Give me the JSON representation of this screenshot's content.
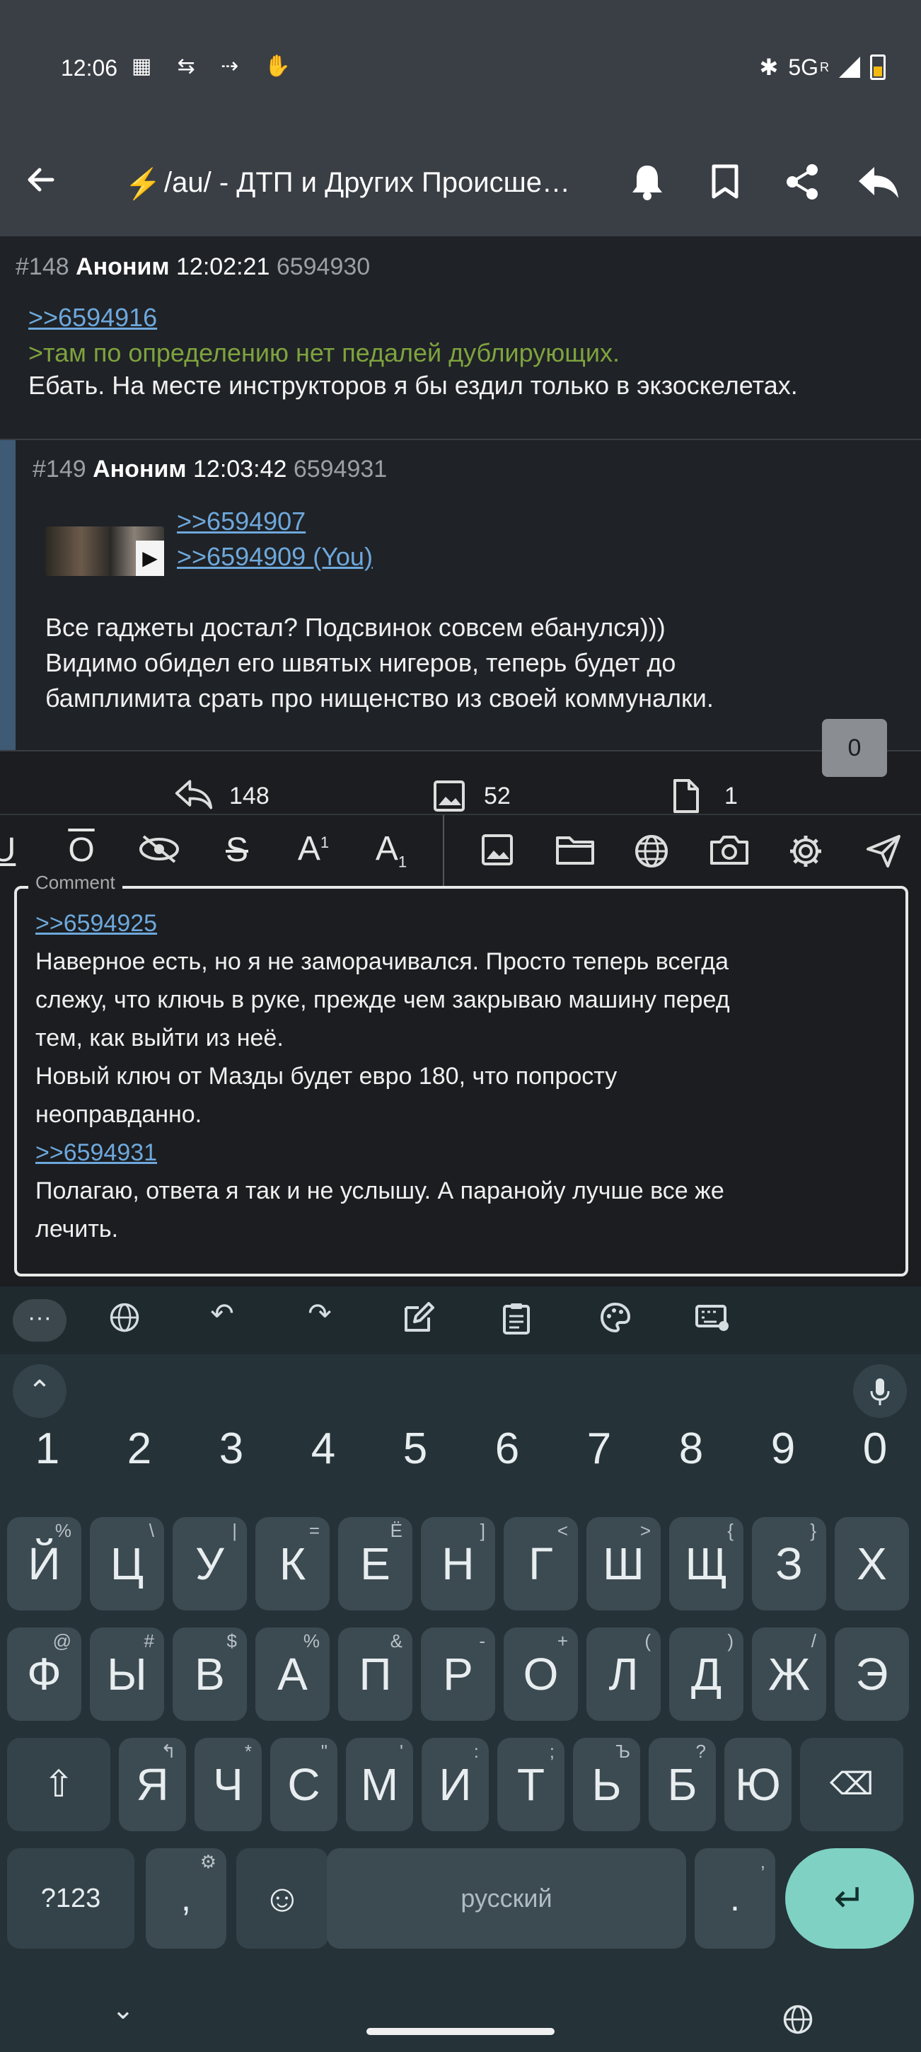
{
  "status_bar": {
    "time": "12:06",
    "left_icons": "▦ ⇆ ⇢ ✋",
    "network": "5G",
    "network_sup": "R"
  },
  "app_bar": {
    "title": "/au/ - ДТП и Других Происшест...",
    "back_icon": "arrow-left-icon",
    "icons": [
      "bell-icon",
      "bookmark-icon",
      "share-icon",
      "reply-icon"
    ]
  },
  "posts": [
    {
      "num": "#148",
      "author": "Аноним",
      "time": "12:02:21",
      "id": "6594930",
      "reply_link": ">>6594916",
      "quote": ">там по определению нет педалей дублирующих.",
      "text": "Ебать. На месте инструкторов я бы ездил только в экзоскелетах."
    },
    {
      "num": "#149",
      "author": "Аноним",
      "time": "12:03:42",
      "id": "6594931",
      "reply_links": [
        ">>6594907",
        ">>6594909 (You)"
      ],
      "text_lines": [
        "Все гаджеты достал? Подсвинок совсем ебанулся)))",
        "Видимо обидел его швятых нигеров, теперь будет до",
        "бамплимита срать про нищенство из своей коммуналки."
      ]
    }
  ],
  "thread_stats": {
    "replies": "148",
    "images": "52",
    "files": "1",
    "badge": "0"
  },
  "comment": {
    "label": "Comment",
    "lines": [
      {
        "text": ">>6594925",
        "link": true
      },
      {
        "text": "Наверное есть, но я не заморачивался. Просто теперь всегда",
        "link": false
      },
      {
        "text": "слежу, что ключь в руке, прежде чем закрываю машину перед",
        "link": false
      },
      {
        "text": "тем, как выйти из неё.",
        "link": false
      },
      {
        "text": "Новый ключ от Мазды будет евро 180, что попросту",
        "link": false
      },
      {
        "text": "неоправданно.",
        "link": false
      },
      {
        "text": ">>6594931",
        "link": true
      },
      {
        "text": "Полагаю, ответа я так и не услышу. А паранойу лучше все же",
        "link": false
      },
      {
        "text": "лечить.",
        "link": false
      }
    ]
  },
  "keyboard": {
    "numbers": [
      "1",
      "2",
      "3",
      "4",
      "5",
      "6",
      "7",
      "8",
      "9",
      "0"
    ],
    "row1": [
      [
        "Й",
        "%"
      ],
      [
        "Ц",
        "\\"
      ],
      [
        "У",
        "|"
      ],
      [
        "К",
        "="
      ],
      [
        "Е",
        "Ё"
      ],
      [
        "Н",
        "]"
      ],
      [
        "Г",
        "<"
      ],
      [
        "Ш",
        ">"
      ],
      [
        "Щ",
        "{"
      ],
      [
        "З",
        "}"
      ],
      [
        "Х",
        ""
      ]
    ],
    "row2": [
      [
        "Ф",
        "@"
      ],
      [
        "Ы",
        "#"
      ],
      [
        "В",
        "$"
      ],
      [
        "А",
        "%"
      ],
      [
        "П",
        "&"
      ],
      [
        "Р",
        "-"
      ],
      [
        "О",
        "+"
      ],
      [
        "Л",
        "("
      ],
      [
        "Д",
        ")"
      ],
      [
        "Ж",
        "/"
      ],
      [
        "Э",
        ""
      ]
    ],
    "row3": [
      [
        "Я",
        "↰"
      ],
      [
        "Ч",
        "*"
      ],
      [
        "С",
        "\""
      ],
      [
        "М",
        "'"
      ],
      [
        "И",
        ":"
      ],
      [
        "Т",
        ";"
      ],
      [
        "Ь",
        "Ъ"
      ],
      [
        "Б",
        "?"
      ],
      [
        "Ю",
        ""
      ]
    ],
    "symbols_key": "?123",
    "comma": ",",
    "space_label": "русский",
    "period": ".",
    "period_hint": ","
  }
}
